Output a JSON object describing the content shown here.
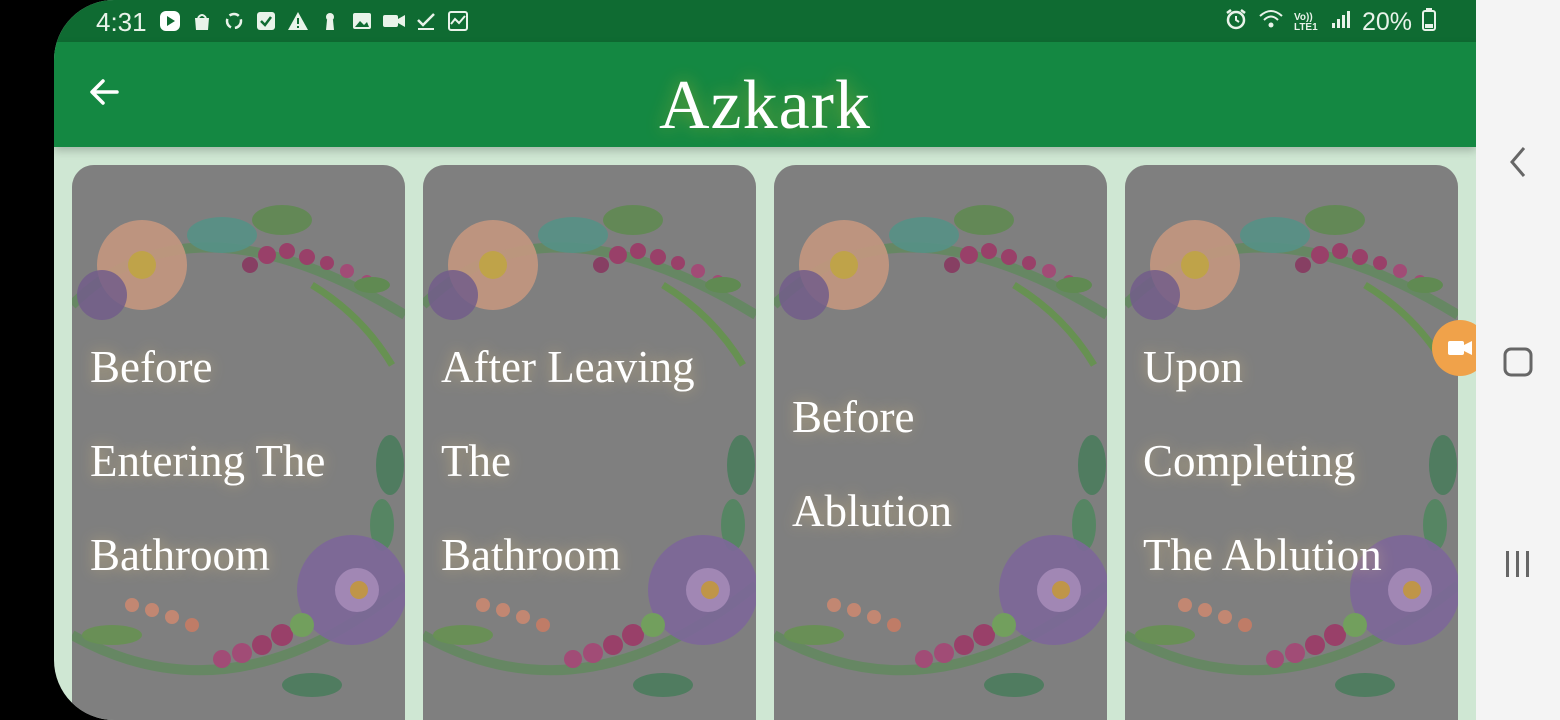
{
  "status_bar": {
    "time": "4:31",
    "battery": "20%",
    "left_icons": [
      "play-store-icon",
      "shopping-bag-icon",
      "sync-icon",
      "checkbox-icon",
      "warning-icon",
      "keyhole-icon",
      "image-icon",
      "video-icon",
      "check-icon",
      "chart-icon"
    ],
    "right_icons": [
      "alarm-icon",
      "wifi-icon",
      "volte-icon",
      "signal-icon",
      "battery-icon"
    ],
    "volte_label": "Vo)) LTE1"
  },
  "app_bar": {
    "title": "Azkark",
    "back_icon": "arrow-left-icon"
  },
  "cards": [
    {
      "lines": [
        "Before",
        "Entering The",
        "Bathroom"
      ]
    },
    {
      "lines": [
        "After Leaving",
        "The",
        "Bathroom"
      ]
    },
    {
      "lines": [
        "Before",
        "Ablution"
      ]
    },
    {
      "lines": [
        "Upon",
        "Completing",
        "The Ablution"
      ]
    }
  ],
  "nav_bar": {
    "back": "chevron-left-icon",
    "home": "home-square-icon",
    "recents": "recents-icon"
  },
  "colors": {
    "status_bar": "#0f6b32",
    "app_bar": "#148842",
    "background": "#cfe7d3",
    "card": "#7f7f7f",
    "text": "#ffffff"
  }
}
